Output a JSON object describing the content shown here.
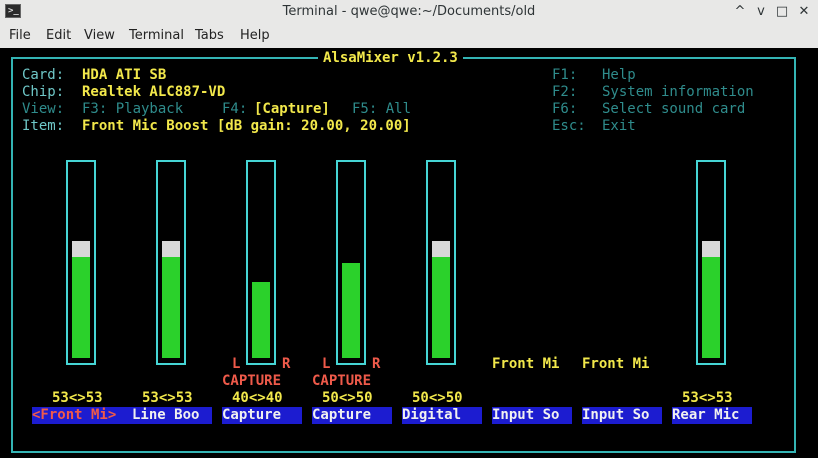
{
  "window": {
    "title": "Terminal - qwe@qwe:~/Documents/old",
    "icon_text": ">_",
    "buttons": [
      "^",
      "v",
      "□",
      "✕"
    ]
  },
  "menu": [
    "File",
    "Edit",
    "View",
    "Terminal",
    "Tabs",
    "Help"
  ],
  "alsamixer": {
    "title": "AlsaMixer v1.2.3",
    "card_label": "Card:",
    "card_value": "HDA ATI SB",
    "chip_label": "Chip:",
    "chip_value": "Realtek ALC887-VD",
    "view_label": "View:",
    "view_playback": "F3: Playback",
    "view_capture_key": "F4:",
    "view_capture": "[Capture]",
    "view_all": "F5: All",
    "item_label": "Item:",
    "item_value": "Front Mic Boost [dB gain: 20.00, 20.00]",
    "help": [
      {
        "key": "F1:",
        "text": "Help"
      },
      {
        "key": "F2:",
        "text": "System information"
      },
      {
        "key": "F6:",
        "text": "Select sound card"
      },
      {
        "key": "Esc:",
        "text": "Exit"
      }
    ],
    "channels": [
      {
        "name": "<Front Mi>",
        "value": "53<>53",
        "level": 0.53,
        "selected": true
      },
      {
        "name": "Line Boo",
        "value": "53<>53",
        "level": 0.53
      },
      {
        "name": "Capture",
        "value": "40<>40",
        "level": 0.4,
        "capture": "CAPTURE",
        "l": "L",
        "r": "R"
      },
      {
        "name": "Capture",
        "value": "50<>50",
        "level": 0.5,
        "capture": "CAPTURE",
        "l": "L",
        "r": "R"
      },
      {
        "name": "Digital",
        "value": "50<>50",
        "level": 0.53
      },
      {
        "name": "Input So",
        "enum": "Front Mi"
      },
      {
        "name": "Input So",
        "enum": "Front Mi"
      },
      {
        "name": "Rear Mic",
        "value": "53<>53",
        "level": 0.53
      }
    ],
    "colors": {
      "frame": "#34b4b4",
      "green_bar": "#2bd12b",
      "label_bg": "#1c1cd0",
      "yellow": "#f2e84b",
      "capture_red": "#ef5a4a"
    }
  }
}
